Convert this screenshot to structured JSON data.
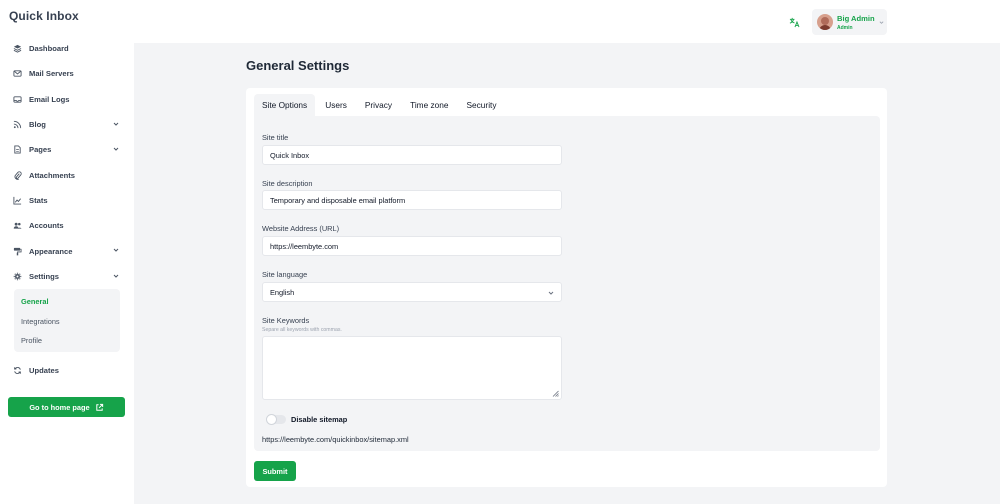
{
  "app": {
    "title": "Quick Inbox"
  },
  "sidebar": {
    "items": [
      {
        "label": "Dashboard",
        "icon": "layers-icon",
        "has_children": false
      },
      {
        "label": "Mail Servers",
        "icon": "mail-icon",
        "has_children": false
      },
      {
        "label": "Email Logs",
        "icon": "inbox-icon",
        "has_children": false
      },
      {
        "label": "Blog",
        "icon": "rss-icon",
        "has_children": true
      },
      {
        "label": "Pages",
        "icon": "file-icon",
        "has_children": true
      },
      {
        "label": "Attachments",
        "icon": "paperclip-icon",
        "has_children": false
      },
      {
        "label": "Stats",
        "icon": "chart-icon",
        "has_children": false
      },
      {
        "label": "Accounts",
        "icon": "users-icon",
        "has_children": false
      },
      {
        "label": "Appearance",
        "icon": "paint-roller-icon",
        "has_children": true
      },
      {
        "label": "Settings",
        "icon": "gear-icon",
        "has_children": true,
        "expanded": true
      },
      {
        "label": "Updates",
        "icon": "refresh-icon",
        "has_children": false
      }
    ],
    "settings_sub": [
      {
        "label": "General",
        "active": true
      },
      {
        "label": "Integrations",
        "active": false
      },
      {
        "label": "Profile",
        "active": false
      }
    ],
    "home_button": "Go to home page"
  },
  "header": {
    "user": {
      "name": "Big Admin",
      "role": "Admin"
    },
    "translate_icon": "translate-icon"
  },
  "main": {
    "title": "General Settings",
    "tabs": [
      {
        "label": "Site Options",
        "active": true
      },
      {
        "label": "Users",
        "active": false
      },
      {
        "label": "Privacy",
        "active": false
      },
      {
        "label": "Time zone",
        "active": false
      },
      {
        "label": "Security",
        "active": false
      }
    ],
    "form": {
      "site_title": {
        "label": "Site title",
        "value": "Quick Inbox"
      },
      "site_description": {
        "label": "Site description",
        "value": "Temporary and disposable email platform"
      },
      "website_address": {
        "label": "Website Address (URL)",
        "value": "https://leembyte.com"
      },
      "site_language": {
        "label": "Site language",
        "value": "English"
      },
      "site_keywords": {
        "label": "Site Keywords",
        "hint": "Separe all keywords with commas.",
        "value": ""
      },
      "disable_sitemap": {
        "label": "Disable sitemap",
        "enabled": false
      },
      "sitemap_url": "https://leembyte.com/quickinbox/sitemap.xml"
    },
    "submit": "Submit"
  },
  "colors": {
    "accent": "#16a34a",
    "background": "#f3f4f6",
    "surface": "#ffffff"
  }
}
